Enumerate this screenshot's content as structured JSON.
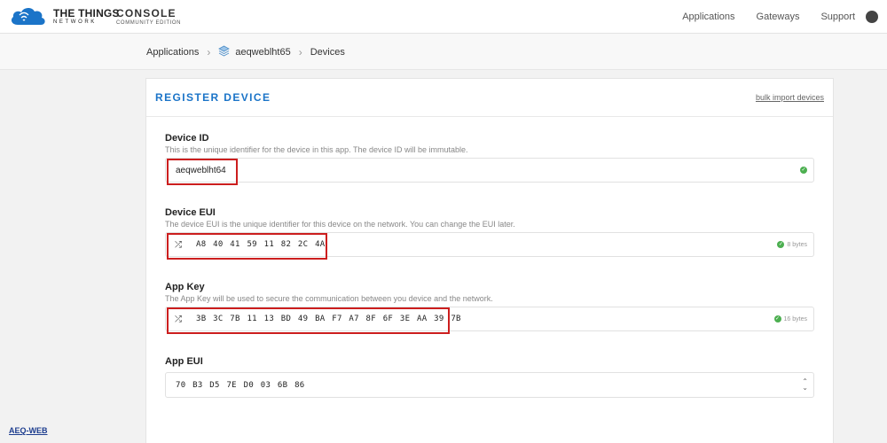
{
  "brand": {
    "name": "THE THINGS",
    "sub": "NETWORK",
    "console": "CONSOLE",
    "edition": "COMMUNITY EDITION"
  },
  "nav": {
    "items": [
      "Applications",
      "Gateways",
      "Support"
    ]
  },
  "breadcrumb": {
    "applications": "Applications",
    "app_id": "aeqweblht65",
    "devices": "Devices"
  },
  "register": {
    "title": "REGISTER DEVICE",
    "bulk_import": "bulk import devices"
  },
  "fields": {
    "device_id": {
      "label": "Device ID",
      "description": "This is the unique identifier for the device in this app. The device ID will be immutable.",
      "value": "aeqweblht64"
    },
    "device_eui": {
      "label": "Device EUI",
      "description": "The device EUI is the unique identifier for this device on the network. You can change the EUI later.",
      "value": "A8 40 41 59 11 82 2C 4A",
      "size": "8 bytes"
    },
    "app_key": {
      "label": "App Key",
      "description": "The App Key will be used to secure the communication between you device and the network.",
      "value": "3B 3C 7B 11 13 BD 49 BA F7 A7 8F 6F 3E AA 39 7B",
      "size": "16 bytes"
    },
    "app_eui": {
      "label": "App EUI",
      "value": "70 B3 D5 7E D0 03 6B 86"
    }
  },
  "icons": {
    "shuffle": "⤮",
    "check": "✓",
    "caret_up": "⌃",
    "caret_down": "⌄",
    "breadcrumb_sep": "›"
  },
  "colors": {
    "accent": "#1b74c8",
    "highlight": "#cc1e1e",
    "valid": "#4caf50"
  },
  "watermark": "AEQ-WEB"
}
